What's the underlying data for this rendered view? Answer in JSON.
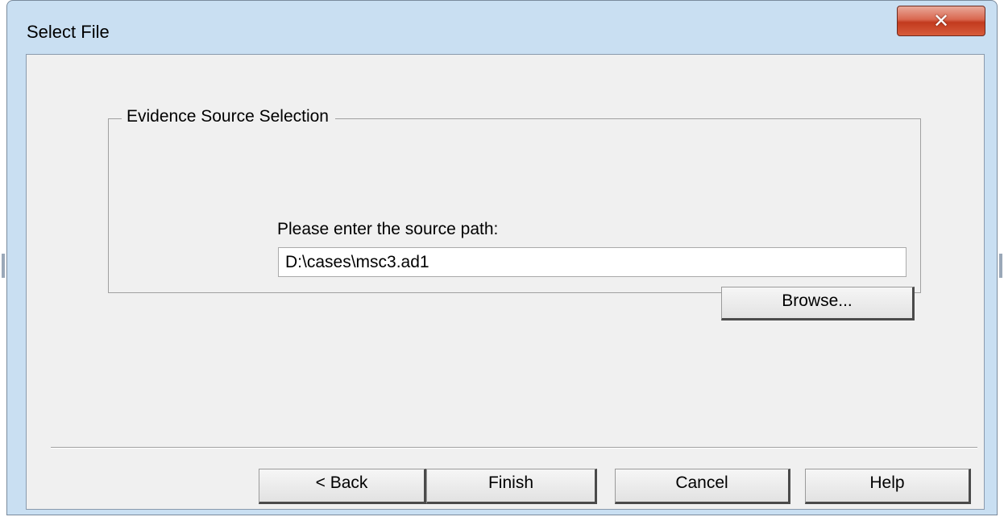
{
  "window": {
    "title": "Select File",
    "close_icon": "close-icon"
  },
  "group": {
    "legend": "Evidence Source Selection",
    "path_label": "Please enter the source path:",
    "path_value": "D:\\cases\\msc3.ad1",
    "browse_label": "Browse..."
  },
  "footer": {
    "back_label": "< Back",
    "finish_label": "Finish",
    "cancel_label": "Cancel",
    "help_label": "Help"
  },
  "colors": {
    "frame": "#c9dff2",
    "client": "#f0f0f0",
    "close_button": "#c23a1e"
  }
}
